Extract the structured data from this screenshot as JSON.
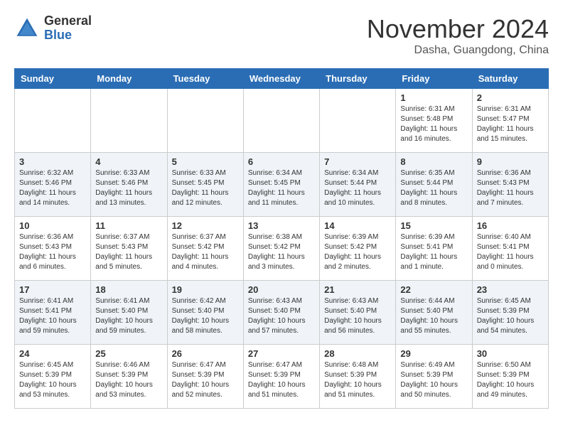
{
  "logo": {
    "general": "General",
    "blue": "Blue"
  },
  "title": "November 2024",
  "subtitle": "Dasha, Guangdong, China",
  "weekdays": [
    "Sunday",
    "Monday",
    "Tuesday",
    "Wednesday",
    "Thursday",
    "Friday",
    "Saturday"
  ],
  "weeks": [
    [
      {
        "day": "",
        "info": ""
      },
      {
        "day": "",
        "info": ""
      },
      {
        "day": "",
        "info": ""
      },
      {
        "day": "",
        "info": ""
      },
      {
        "day": "",
        "info": ""
      },
      {
        "day": "1",
        "info": "Sunrise: 6:31 AM\nSunset: 5:48 PM\nDaylight: 11 hours and 16 minutes."
      },
      {
        "day": "2",
        "info": "Sunrise: 6:31 AM\nSunset: 5:47 PM\nDaylight: 11 hours and 15 minutes."
      }
    ],
    [
      {
        "day": "3",
        "info": "Sunrise: 6:32 AM\nSunset: 5:46 PM\nDaylight: 11 hours and 14 minutes."
      },
      {
        "day": "4",
        "info": "Sunrise: 6:33 AM\nSunset: 5:46 PM\nDaylight: 11 hours and 13 minutes."
      },
      {
        "day": "5",
        "info": "Sunrise: 6:33 AM\nSunset: 5:45 PM\nDaylight: 11 hours and 12 minutes."
      },
      {
        "day": "6",
        "info": "Sunrise: 6:34 AM\nSunset: 5:45 PM\nDaylight: 11 hours and 11 minutes."
      },
      {
        "day": "7",
        "info": "Sunrise: 6:34 AM\nSunset: 5:44 PM\nDaylight: 11 hours and 10 minutes."
      },
      {
        "day": "8",
        "info": "Sunrise: 6:35 AM\nSunset: 5:44 PM\nDaylight: 11 hours and 8 minutes."
      },
      {
        "day": "9",
        "info": "Sunrise: 6:36 AM\nSunset: 5:43 PM\nDaylight: 11 hours and 7 minutes."
      }
    ],
    [
      {
        "day": "10",
        "info": "Sunrise: 6:36 AM\nSunset: 5:43 PM\nDaylight: 11 hours and 6 minutes."
      },
      {
        "day": "11",
        "info": "Sunrise: 6:37 AM\nSunset: 5:43 PM\nDaylight: 11 hours and 5 minutes."
      },
      {
        "day": "12",
        "info": "Sunrise: 6:37 AM\nSunset: 5:42 PM\nDaylight: 11 hours and 4 minutes."
      },
      {
        "day": "13",
        "info": "Sunrise: 6:38 AM\nSunset: 5:42 PM\nDaylight: 11 hours and 3 minutes."
      },
      {
        "day": "14",
        "info": "Sunrise: 6:39 AM\nSunset: 5:42 PM\nDaylight: 11 hours and 2 minutes."
      },
      {
        "day": "15",
        "info": "Sunrise: 6:39 AM\nSunset: 5:41 PM\nDaylight: 11 hours and 1 minute."
      },
      {
        "day": "16",
        "info": "Sunrise: 6:40 AM\nSunset: 5:41 PM\nDaylight: 11 hours and 0 minutes."
      }
    ],
    [
      {
        "day": "17",
        "info": "Sunrise: 6:41 AM\nSunset: 5:41 PM\nDaylight: 10 hours and 59 minutes."
      },
      {
        "day": "18",
        "info": "Sunrise: 6:41 AM\nSunset: 5:40 PM\nDaylight: 10 hours and 59 minutes."
      },
      {
        "day": "19",
        "info": "Sunrise: 6:42 AM\nSunset: 5:40 PM\nDaylight: 10 hours and 58 minutes."
      },
      {
        "day": "20",
        "info": "Sunrise: 6:43 AM\nSunset: 5:40 PM\nDaylight: 10 hours and 57 minutes."
      },
      {
        "day": "21",
        "info": "Sunrise: 6:43 AM\nSunset: 5:40 PM\nDaylight: 10 hours and 56 minutes."
      },
      {
        "day": "22",
        "info": "Sunrise: 6:44 AM\nSunset: 5:40 PM\nDaylight: 10 hours and 55 minutes."
      },
      {
        "day": "23",
        "info": "Sunrise: 6:45 AM\nSunset: 5:39 PM\nDaylight: 10 hours and 54 minutes."
      }
    ],
    [
      {
        "day": "24",
        "info": "Sunrise: 6:45 AM\nSunset: 5:39 PM\nDaylight: 10 hours and 53 minutes."
      },
      {
        "day": "25",
        "info": "Sunrise: 6:46 AM\nSunset: 5:39 PM\nDaylight: 10 hours and 53 minutes."
      },
      {
        "day": "26",
        "info": "Sunrise: 6:47 AM\nSunset: 5:39 PM\nDaylight: 10 hours and 52 minutes."
      },
      {
        "day": "27",
        "info": "Sunrise: 6:47 AM\nSunset: 5:39 PM\nDaylight: 10 hours and 51 minutes."
      },
      {
        "day": "28",
        "info": "Sunrise: 6:48 AM\nSunset: 5:39 PM\nDaylight: 10 hours and 51 minutes."
      },
      {
        "day": "29",
        "info": "Sunrise: 6:49 AM\nSunset: 5:39 PM\nDaylight: 10 hours and 50 minutes."
      },
      {
        "day": "30",
        "info": "Sunrise: 6:50 AM\nSunset: 5:39 PM\nDaylight: 10 hours and 49 minutes."
      }
    ]
  ]
}
